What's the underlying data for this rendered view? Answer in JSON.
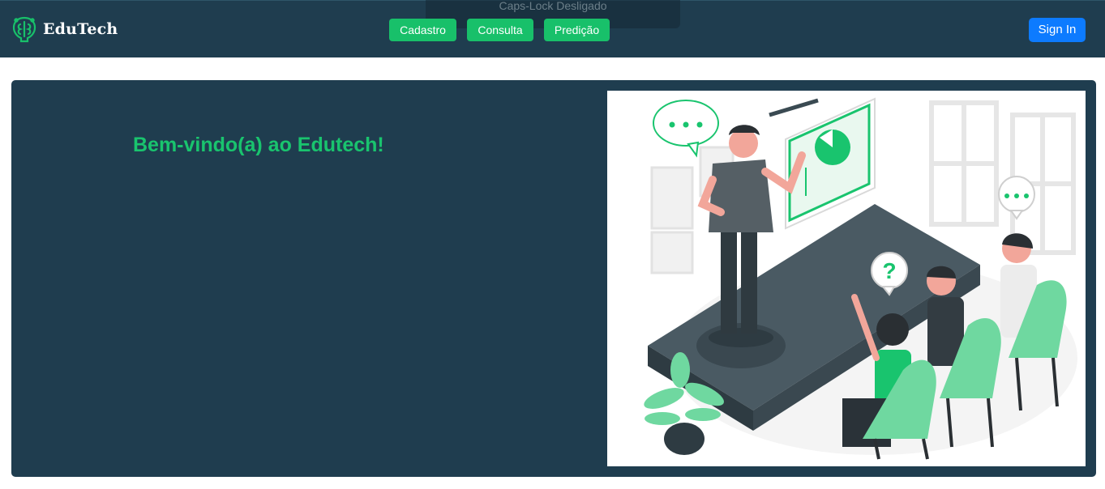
{
  "navbar": {
    "brand": "EduTech",
    "links": [
      "Cadastro",
      "Consulta",
      "Predição"
    ],
    "signin_label": "Sign In",
    "caps_lock_status": "Caps-Lock Desligado"
  },
  "hero": {
    "title": "Bem-vindo(a) ao Edutech!"
  },
  "illustration": {
    "question_mark": "?"
  },
  "colors": {
    "navbar_bg": "#1f3d4f",
    "accent_green": "#18c06a",
    "signin_blue": "#0d7bff"
  }
}
